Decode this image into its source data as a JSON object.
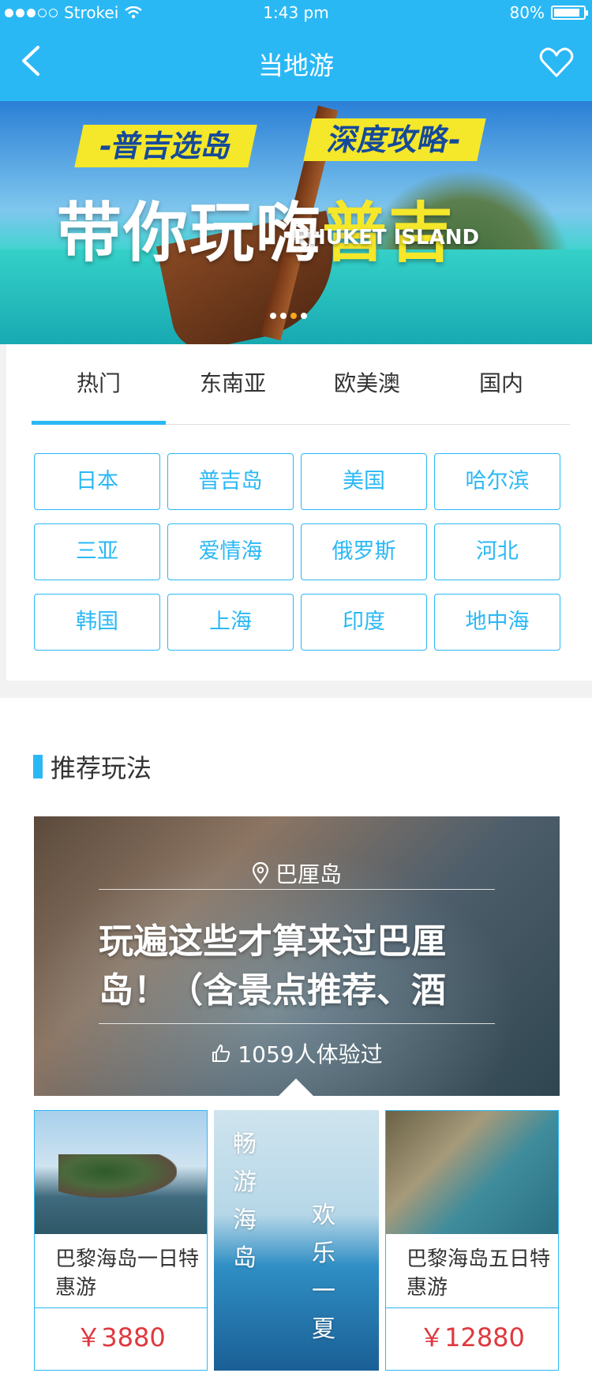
{
  "status": {
    "carrier": "Strokei",
    "time": "1:43 pm",
    "battery": "80%",
    "battery_level": 0.8
  },
  "nav": {
    "title": "当地游",
    "back_icon": "chevron-left-icon",
    "fav_icon": "heart-icon"
  },
  "banner": {
    "ribbon_left": "-普吉选岛",
    "ribbon_right": "深度攻略-",
    "headline_white": "带你玩嗨",
    "headline_yellow": "普吉",
    "subtitle": "PHUKET ISLAND",
    "page_count": 4,
    "active_page": 2
  },
  "tabs": [
    {
      "label": "热门",
      "active": true
    },
    {
      "label": "东南亚",
      "active": false
    },
    {
      "label": "欧美澳",
      "active": false
    },
    {
      "label": "国内",
      "active": false
    }
  ],
  "tags": [
    "日本",
    "普吉岛",
    "美国",
    "哈尔滨",
    "三亚",
    "爱情海",
    "俄罗斯",
    "河北",
    "韩国",
    "上海",
    "印度",
    "地中海"
  ],
  "recommend": {
    "heading": "推荐玩法",
    "hero": {
      "location": "巴厘岛",
      "title": "玩遍这些才算来过巴厘岛！（含景点推荐、酒",
      "count": "1059人体验过"
    },
    "cards": [
      {
        "name": "巴黎海岛一日特惠游",
        "price": "￥3880"
      },
      {
        "name": "巴黎海岛五日特惠游",
        "price": "￥12880"
      }
    ],
    "promo": {
      "line1": "畅游海岛",
      "line2": "欢乐一夏"
    }
  },
  "colors": {
    "primary": "#2ab8f5",
    "price": "#e0383f",
    "banner_yellow": "#f5e72a"
  }
}
